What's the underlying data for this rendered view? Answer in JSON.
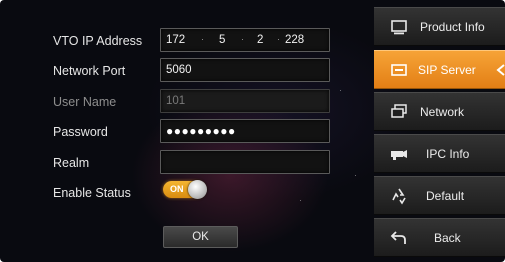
{
  "form": {
    "vto_ip": {
      "label": "VTO IP Address",
      "octets": [
        "172",
        "5",
        "2",
        "228"
      ]
    },
    "network_port": {
      "label": "Network Port",
      "value": "5060"
    },
    "user_name": {
      "label": "User Name",
      "value": "101"
    },
    "password": {
      "label": "Password",
      "value": "●●●●●●●●●"
    },
    "realm": {
      "label": "Realm",
      "value": ""
    },
    "enable_status": {
      "label": "Enable Status",
      "toggle_text": "ON",
      "enabled": true
    },
    "ok_label": "OK"
  },
  "menu": {
    "items": [
      {
        "label": "Product Info",
        "icon": "monitor-icon",
        "active": false
      },
      {
        "label": "SIP Server",
        "icon": "sip-server-icon",
        "active": true
      },
      {
        "label": "Network",
        "icon": "network-icon",
        "active": false
      },
      {
        "label": "IPC Info",
        "icon": "camera-icon",
        "active": false
      },
      {
        "label": "Default",
        "icon": "recycle-icon",
        "active": false
      },
      {
        "label": "Back",
        "icon": "back-arrow-icon",
        "active": false
      }
    ]
  },
  "colors": {
    "accent": "#f0932a",
    "toggle_on": "#f4b531",
    "background": "#090a10"
  }
}
